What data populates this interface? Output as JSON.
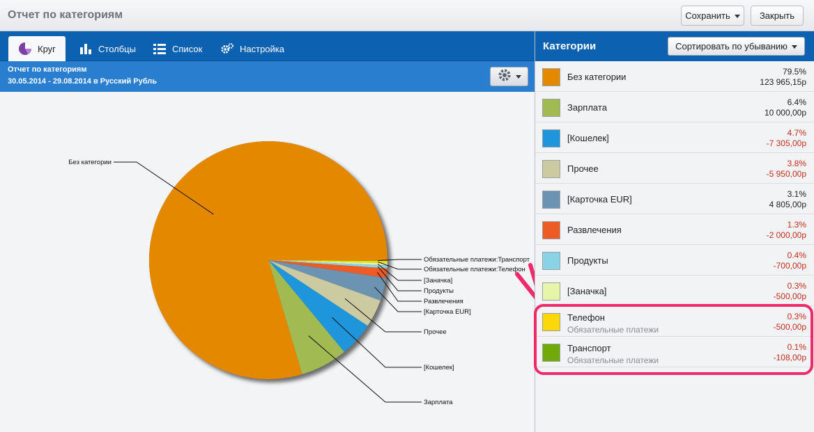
{
  "window": {
    "title": "Отчет по категориям",
    "save_label": "Сохранить",
    "close_label": "Закрыть"
  },
  "tabs": [
    {
      "label": "Круг",
      "icon": "pie-chart-icon",
      "active": true
    },
    {
      "label": "Столбцы",
      "icon": "bar-chart-icon",
      "active": false
    },
    {
      "label": "Список",
      "icon": "list-icon",
      "active": false
    },
    {
      "label": "Настройка",
      "icon": "gears-icon",
      "active": false
    }
  ],
  "report": {
    "title": "Отчет по категориям",
    "subtitle": "30.05.2014 - 29.08.2014 в Русский Рубль"
  },
  "categories_panel": {
    "title": "Категории",
    "sort_label": "Сортировать по убыванию"
  },
  "categories": [
    {
      "name": "Без категории",
      "sub": "",
      "pct": "79.5%",
      "amount": "123 965,15р",
      "color": "#e48800",
      "negative": false
    },
    {
      "name": "Зарплата",
      "sub": "",
      "pct": "6.4%",
      "amount": "10 000,00р",
      "color": "#a2ba52",
      "negative": false
    },
    {
      "name": "[Кошелек]",
      "sub": "",
      "pct": "4.7%",
      "amount": "-7 305,00р",
      "color": "#1f96dc",
      "negative": true
    },
    {
      "name": "Прочее",
      "sub": "",
      "pct": "3.8%",
      "amount": "-5 950,00р",
      "color": "#cbcaa0",
      "negative": true
    },
    {
      "name": "[Карточка EUR]",
      "sub": "",
      "pct": "3.1%",
      "amount": "4 805,00р",
      "color": "#6c93b1",
      "negative": false
    },
    {
      "name": "Развлечения",
      "sub": "",
      "pct": "1.3%",
      "amount": "-2 000,00р",
      "color": "#ec5c24",
      "negative": true
    },
    {
      "name": "Продукты",
      "sub": "",
      "pct": "0.4%",
      "amount": "-700,00р",
      "color": "#8ad2e6",
      "negative": true
    },
    {
      "name": "[Заначка]",
      "sub": "",
      "pct": "0.3%",
      "amount": "-500,00р",
      "color": "#e6f5a8",
      "negative": true
    },
    {
      "name": "Телефон",
      "sub": "Обязательные платежи",
      "pct": "0.3%",
      "amount": "-500,00р",
      "color": "#fcd70a",
      "negative": true
    },
    {
      "name": "Транспорт",
      "sub": "Обязательные платежи",
      "pct": "0.1%",
      "amount": "-108,00р",
      "color": "#70aa08",
      "negative": true
    }
  ],
  "chart_data": {
    "type": "pie",
    "slices": [
      {
        "label": "Без категории",
        "value": 79.5,
        "color": "#e48800"
      },
      {
        "label": "Зарплата",
        "value": 6.4,
        "color": "#a2ba52"
      },
      {
        "label": "[Кошелек]",
        "value": 4.7,
        "color": "#1f96dc"
      },
      {
        "label": "Прочее",
        "value": 3.8,
        "color": "#cbcaa0"
      },
      {
        "label": "[Карточка EUR]",
        "value": 3.1,
        "color": "#6c93b1"
      },
      {
        "label": "Развлечения",
        "value": 1.3,
        "color": "#ec5c24"
      },
      {
        "label": "Продукты",
        "value": 0.4,
        "color": "#8ad2e6"
      },
      {
        "label": "[Заначка]",
        "value": 0.3,
        "color": "#e6f5a8"
      },
      {
        "label": "Обязательные платежи:Телефон",
        "value": 0.3,
        "color": "#fcd70a"
      },
      {
        "label": "Обязательные платежи:Транспорт",
        "value": 0.1,
        "color": "#70aa08"
      }
    ]
  }
}
